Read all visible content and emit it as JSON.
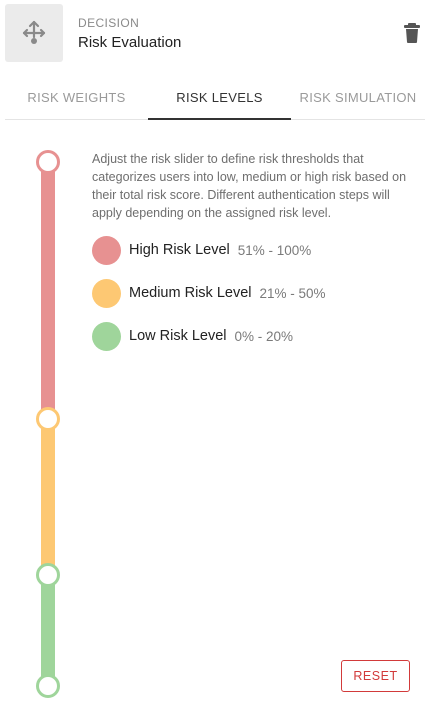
{
  "header": {
    "node_type": "DECISION",
    "node_name": "Risk Evaluation",
    "node_icon": "decision-split-icon",
    "delete_icon": "trash-icon"
  },
  "tabs": [
    {
      "label": "RISK WEIGHTS",
      "active": false
    },
    {
      "label": "RISK LEVELS",
      "active": true
    },
    {
      "label": "RISK SIMULATION",
      "active": false
    }
  ],
  "description": "Adjust the risk slider to define risk thresholds that categorizes users into low, medium or high risk based on their total risk score. Different authentication steps will apply depending on the assigned risk level.",
  "levels": [
    {
      "name": "High Risk Level",
      "range": "51% - 100%",
      "color": "#e79191"
    },
    {
      "name": "Medium Risk Level",
      "range": "21% - 50%",
      "color": "#fdc873"
    },
    {
      "name": "Low Risk Level",
      "range": "0% - 20%",
      "color": "#9fd59b"
    }
  ],
  "slider": {
    "thresholds": [
      100,
      50,
      20,
      0
    ],
    "colors": {
      "high": "#e79191",
      "medium": "#fdc873",
      "low": "#9fd59b"
    }
  },
  "buttons": {
    "reset_label": "RESET",
    "reset_color": "#d23a3a"
  }
}
